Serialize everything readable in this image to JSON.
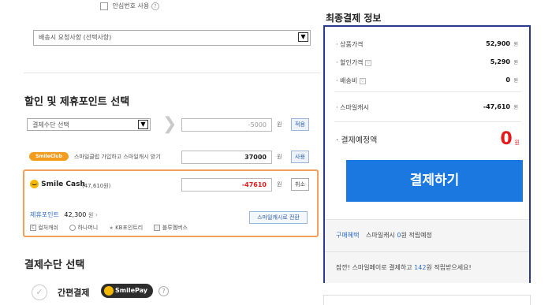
{
  "safe_number": {
    "label": "안심번호 사용"
  },
  "delivery_request": {
    "value": "배송시 요청사항 (선택사항)"
  },
  "discount_section": {
    "title": "할인 및 제휴포인트 선택",
    "payment_method_select": "결제수단 선택",
    "discount_value": "-5000",
    "unit": "원",
    "apply_label": "적용",
    "smileclub_badge": "SmileClub",
    "smileclub_text": "스마일클럽 가입하고 스마일캐시 받기",
    "smileclub_value": "37000",
    "use_label": "사용",
    "smilecash_logo": "Smile Cash",
    "smilecash_balance": "(47,610원)",
    "smilecash_value": "-47610",
    "cancel_label": "취소",
    "partner_point_label": "제휴포인트",
    "partner_point_value": "42,300",
    "partner_point_unit": "원",
    "convert_label": "스마일캐시로 전환",
    "partners": [
      "컬처캐쉬",
      "하나머니",
      "KB포인트리",
      "블루멤버스"
    ]
  },
  "payment_section": {
    "title": "결제수단 선택",
    "easy_pay_label": "간편결제",
    "smilepay_logo": "SmilePay"
  },
  "summary": {
    "title": "최종결제 정보",
    "rows": [
      {
        "label": "상품가격",
        "value": "52,900",
        "unit": "원"
      },
      {
        "label": "할인가격",
        "value": "5,290",
        "unit": "원"
      },
      {
        "label": "배송비",
        "value": "0",
        "unit": "원"
      },
      {
        "label": "스마일캐시",
        "value": "-47,610",
        "unit": "원"
      }
    ],
    "total_label": "결제예정액",
    "total_value": "0",
    "total_unit": "원",
    "pay_button": "결제하기",
    "buy_benefit_label": "구매혜택",
    "buy_benefit_text_prefix": "스마일캐시",
    "buy_benefit_amount": "0",
    "buy_benefit_text_suffix": "원 적립예정",
    "promo_prefix": "잠깐! 스마일페이로 결제하고",
    "promo_amount": "142",
    "promo_suffix": "원 적립받으세요!"
  },
  "colors": {
    "accent_blue": "#1a78e0",
    "panel_border": "#2a3a8c",
    "red": "#e31b1b",
    "orange": "#f5a05a"
  }
}
